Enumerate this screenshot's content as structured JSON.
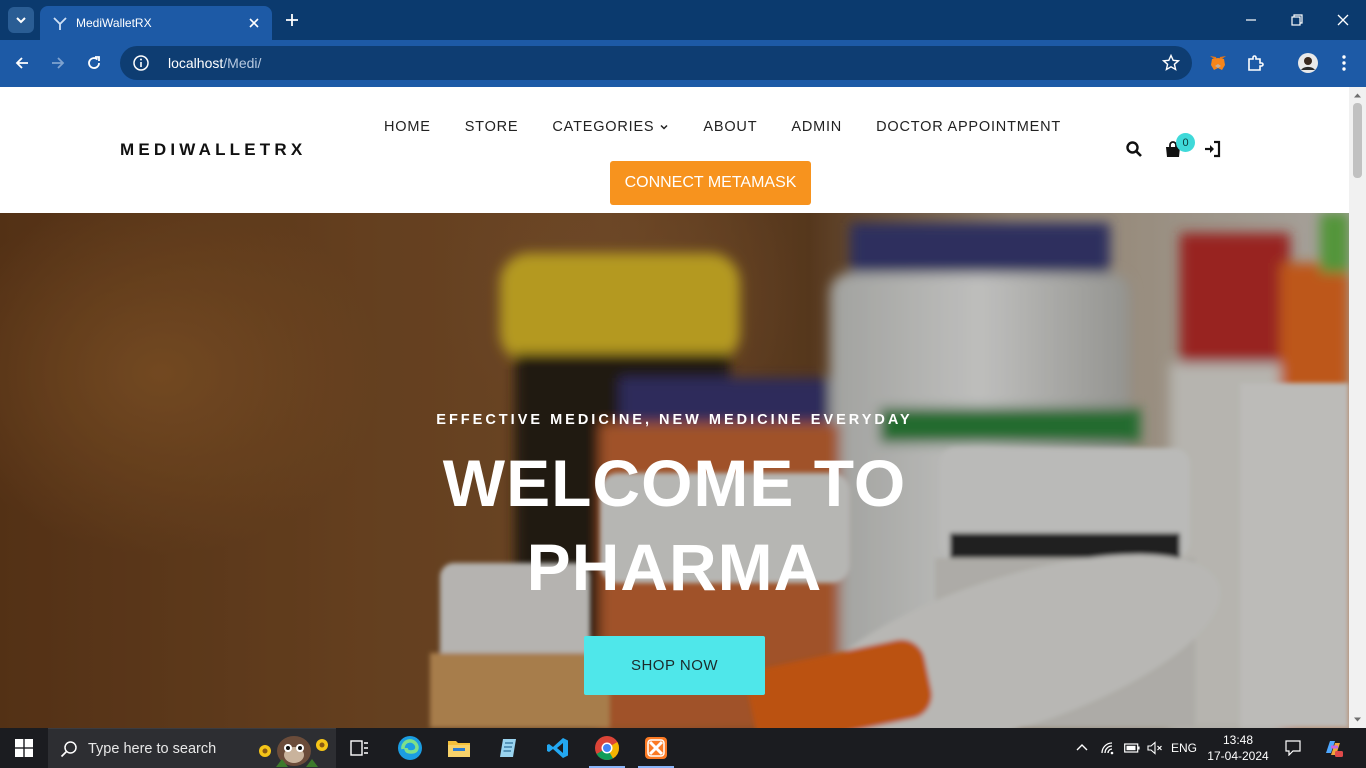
{
  "browser": {
    "tab_title": "MediWalletRX",
    "url_host": "localhost",
    "url_path": "/Medi/"
  },
  "site": {
    "brand": "MEDIWALLETRX",
    "nav": [
      "HOME",
      "STORE",
      "CATEGORIES",
      "ABOUT",
      "ADMIN",
      "DOCTOR APPOINTMENT"
    ],
    "connect_button": "CONNECT METAMASK",
    "cart_count": "0"
  },
  "hero": {
    "subtitle": "EFFECTIVE MEDICINE, NEW MEDICINE EVERYDAY",
    "title_line1": "WELCOME TO",
    "title_line2": "PHARMA",
    "button": "SHOP NOW"
  },
  "taskbar": {
    "search_placeholder": "Type here to search",
    "language": "ENG",
    "time": "13:48",
    "date": "17-04-2024"
  },
  "colors": {
    "chrome_dark": "#0b3a6e",
    "chrome_tab": "#1d5aa6",
    "metamask_orange": "#f7931e",
    "shop_cyan": "#4fe7ea",
    "badge_cyan": "#3fd9d9"
  }
}
